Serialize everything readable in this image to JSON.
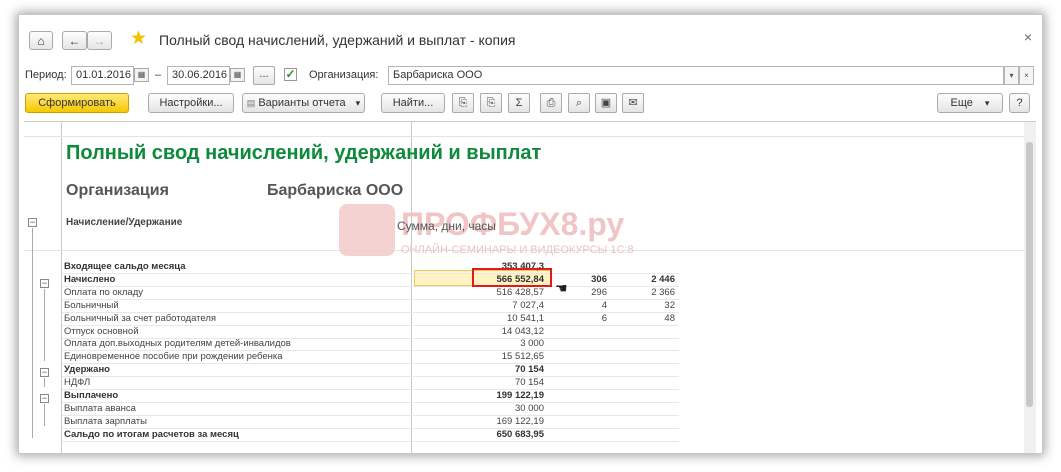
{
  "window": {
    "title": "Полный свод начислений, удержаний и выплат - копия",
    "close_glyph": "×"
  },
  "nav": {
    "home_icon": "home-icon",
    "back_glyph": "←",
    "forward_glyph": "→",
    "favorite_icon": "star-icon"
  },
  "params": {
    "period_label": "Период:",
    "date_from": "01.01.2016",
    "dash": "–",
    "date_to": "30.06.2016",
    "dots_label": "...",
    "org_label": "Организация:",
    "org_value": "Барбариска ООО",
    "dropdown_glyph": "▾",
    "clear_glyph": "×"
  },
  "toolbar": {
    "generate_label": "Сформировать",
    "settings_label": "Настройки...",
    "variants_label": "Варианты отчета",
    "find_label": "Найти...",
    "sum_glyph": "Σ",
    "more_label": "Еще",
    "help_label": "?",
    "dropdown_glyph": "▾"
  },
  "report": {
    "title": "Полный свод начислений, удержаний и выплат",
    "org_label": "Организация",
    "org_value": "Барбариска ООО",
    "col_header_name": "Начисление/Удержание",
    "col_header_values": "Сумма, дни, часы",
    "rows": [
      {
        "name": "Входящее сальдо месяца",
        "v1": "353 407,3",
        "v2": "",
        "v3": "",
        "bold": true
      },
      {
        "name": "Начислено",
        "v1": "566 552,84",
        "v2": "306",
        "v3": "2 446",
        "bold": true
      },
      {
        "name": "Оплата по окладу",
        "v1": "516 428,57",
        "v2": "296",
        "v3": "2 366",
        "bold": false
      },
      {
        "name": "Больничный",
        "v1": "7 027,4",
        "v2": "4",
        "v3": "32",
        "bold": false
      },
      {
        "name": "Больничный за счет работодателя",
        "v1": "10 541,1",
        "v2": "6",
        "v3": "48",
        "bold": false
      },
      {
        "name": "Отпуск основной",
        "v1": "14 043,12",
        "v2": "",
        "v3": "",
        "bold": false
      },
      {
        "name": "Оплата доп.выходных родителям детей-инвалидов",
        "v1": "3 000",
        "v2": "",
        "v3": "",
        "bold": false
      },
      {
        "name": "Единовременное пособие при рождении ребенка",
        "v1": "15 512,65",
        "v2": "",
        "v3": "",
        "bold": false
      },
      {
        "name": "Удержано",
        "v1": "70 154",
        "v2": "",
        "v3": "",
        "bold": true
      },
      {
        "name": "НДФЛ",
        "v1": "70 154",
        "v2": "",
        "v3": "",
        "bold": false
      },
      {
        "name": "Выплачено",
        "v1": "199 122,19",
        "v2": "",
        "v3": "",
        "bold": true
      },
      {
        "name": "Выплата аванса",
        "v1": "30 000",
        "v2": "",
        "v3": "",
        "bold": false
      },
      {
        "name": "Выплата зарплаты",
        "v1": "169 122,19",
        "v2": "",
        "v3": "",
        "bold": false
      },
      {
        "name": "Сальдо по итогам расчетов за месяц",
        "v1": "650 683,95",
        "v2": "",
        "v3": "",
        "bold": true
      }
    ],
    "watermark_text": "ПРОФБУХ8.ру",
    "watermark_sub": "ОНЛАЙН-СЕМИНАРЫ И ВИДЕОКУРСЫ 1С:8"
  },
  "colors": {
    "accent_green": "#0d8a3a",
    "highlight_red": "#e01b1b",
    "primary_button": "#f5c800"
  }
}
